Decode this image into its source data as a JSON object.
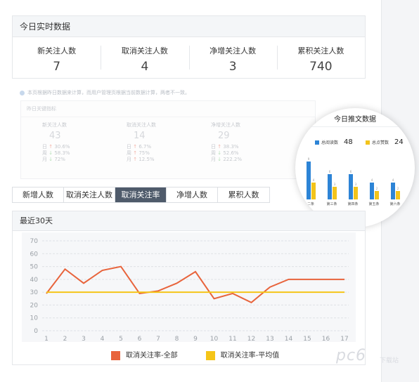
{
  "realtime": {
    "title": "今日实时数据",
    "stats": [
      {
        "label": "新关注人数",
        "value": "7"
      },
      {
        "label": "取消关注人数",
        "value": "4"
      },
      {
        "label": "净增关注人数",
        "value": "3"
      },
      {
        "label": "累积关注人数",
        "value": "740"
      }
    ]
  },
  "note": "本页根据昨日数据来计算，而用户管理页根据当前数据计算，两者不一致。",
  "ghost": {
    "title": "昨日关键指标",
    "cols": [
      {
        "label": "新关注人数",
        "value": "43",
        "rows": [
          {
            "k": "日",
            "a": "↑",
            "v": "30.6%"
          },
          {
            "k": "周",
            "a": "↓",
            "v": "58.3%"
          },
          {
            "k": "月",
            "a": "↓",
            "v": "72%"
          }
        ]
      },
      {
        "label": "取消关注人数",
        "value": "14",
        "rows": [
          {
            "k": "日",
            "a": "↑",
            "v": "6.7%"
          },
          {
            "k": "周",
            "a": "↑",
            "v": "75%"
          },
          {
            "k": "月",
            "a": "↑",
            "v": "12.5%"
          }
        ]
      },
      {
        "label": "净增关注人数",
        "value": "29",
        "rows": [
          {
            "k": "日",
            "a": "↑",
            "v": "38.3%"
          },
          {
            "k": "周",
            "a": "↓",
            "v": "52.6%"
          },
          {
            "k": "月",
            "a": "↓",
            "v": "222.2%"
          }
        ]
      }
    ]
  },
  "popup": {
    "title": "今日推文数据",
    "legend": [
      {
        "label": "总阅读数",
        "value": "48",
        "color": "#2d84d6"
      },
      {
        "label": "总点赞数",
        "value": "24",
        "color": "#f3c41b"
      }
    ],
    "mini_chart": {
      "categories": [
        "二条",
        "第三条",
        "第四条",
        "第五条",
        "第六条"
      ],
      "series": [
        {
          "name": "总阅读数",
          "values": [
            9,
            6,
            6,
            4,
            4
          ],
          "color": "#2d84d6"
        },
        {
          "name": "总点赞数",
          "values": [
            4,
            3,
            3,
            2,
            2
          ],
          "color": "#f3c41b"
        }
      ]
    }
  },
  "tabs": [
    {
      "label": "新增人数",
      "active": false
    },
    {
      "label": "取消关注人数",
      "active": false
    },
    {
      "label": "取消关注率",
      "active": true
    },
    {
      "label": "净增人数",
      "active": false
    },
    {
      "label": "累积人数",
      "active": false
    }
  ],
  "chart_panel": {
    "title": "最近30天"
  },
  "chart_data": {
    "type": "line",
    "x": [
      1,
      2,
      3,
      4,
      5,
      6,
      7,
      8,
      9,
      10,
      11,
      12,
      13,
      14,
      15,
      16,
      17
    ],
    "series": [
      {
        "name": "取消关注率-全部",
        "color": "#e8643c",
        "values": [
          29,
          48,
          37,
          47,
          50,
          29,
          31,
          37,
          46,
          25,
          29,
          22,
          34,
          40,
          40,
          40,
          40
        ]
      },
      {
        "name": "取消关注率-平均值",
        "color": "#f5c518",
        "values": [
          30,
          30,
          30,
          30,
          30,
          30,
          30,
          30,
          30,
          30,
          30,
          30,
          30,
          30,
          30,
          30,
          30
        ]
      }
    ],
    "ylim": [
      0,
      70
    ],
    "yticks": [
      0,
      10,
      20,
      30,
      40,
      50,
      60,
      70
    ],
    "grid": true,
    "legend_position": "bottom"
  },
  "watermark": {
    "text": "pc6",
    "sub": "下载站"
  }
}
